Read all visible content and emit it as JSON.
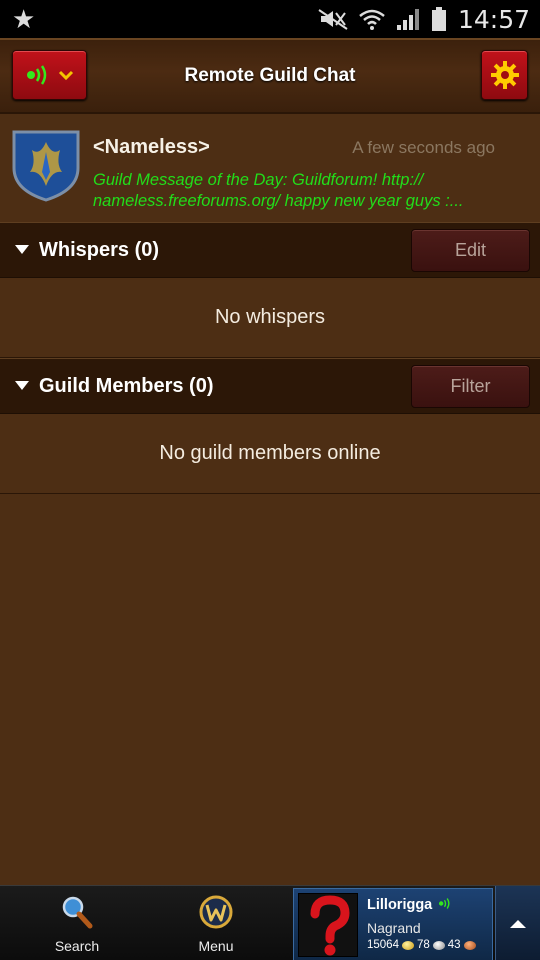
{
  "status_bar": {
    "time": "14:57",
    "icons": [
      "star-icon",
      "mute-icon",
      "wifi-icon",
      "signal-icon",
      "battery-icon"
    ]
  },
  "header": {
    "title": "Remote Guild Chat",
    "status_icon": "sound-waves-icon",
    "dropdown_icon": "chevron-down-icon",
    "settings_icon": "gear-icon"
  },
  "guild": {
    "name": "<Nameless>",
    "time": "A few seconds ago",
    "motd": "Guild Message of the Day:  Guildforum! http:// nameless.freeforums.org/   happy new year guys :..."
  },
  "whispers": {
    "title": "Whispers (0)",
    "button_label": "Edit",
    "empty_text": "No whispers"
  },
  "guild_members": {
    "title": "Guild Members (0)",
    "button_label": "Filter",
    "empty_text": "No guild members online"
  },
  "bottom_bar": {
    "search_label": "Search",
    "menu_label": "Menu",
    "character": {
      "name": "Lillorigga",
      "realm": "Nagrand",
      "gold": "15064",
      "silver": "78",
      "copper": "43"
    }
  },
  "colors": {
    "background": "#4d2e14",
    "section_header": "#2c1707",
    "accent_red": "#b3101a",
    "motd_green": "#22dd1a",
    "gear_yellow": "#ffcc00"
  }
}
